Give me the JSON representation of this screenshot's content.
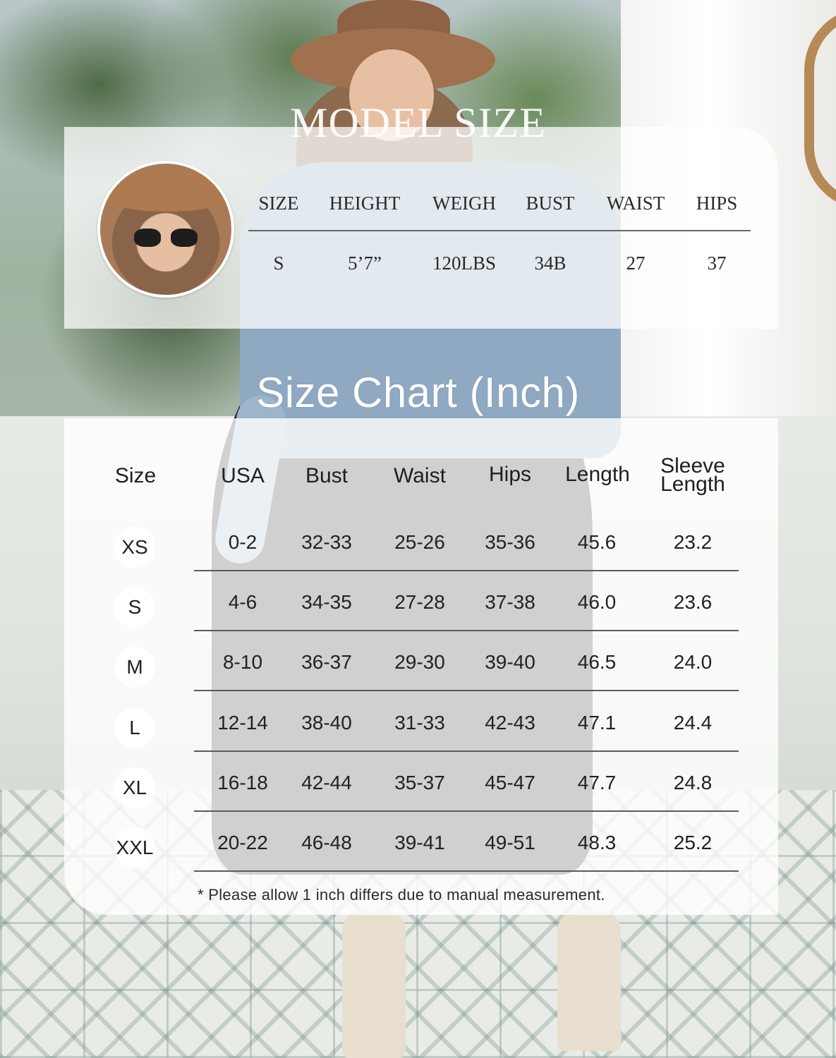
{
  "model_size": {
    "title": "MODEL SIZE",
    "headers": [
      "SIZE",
      "HEIGHT",
      "WEIGH",
      "BUST",
      "WAIST",
      "HIPS"
    ],
    "values": [
      "S",
      "5’7”",
      "120LBS",
      "34B",
      "27",
      "37"
    ]
  },
  "size_chart": {
    "title": "Size Chart (Inch)",
    "headers": [
      "Size",
      "USA",
      "Bust",
      "Waist",
      "Hips",
      "Length"
    ],
    "sleeve_header_line1": "Sleeve",
    "sleeve_header_line2": "Length",
    "rows": [
      {
        "size": "XS",
        "usa": "0-2",
        "bust": "32-33",
        "waist": "25-26",
        "hips": "35-36",
        "length": "45.6",
        "sleeve": "23.2"
      },
      {
        "size": "S",
        "usa": "4-6",
        "bust": "34-35",
        "waist": "27-28",
        "hips": "37-38",
        "length": "46.0",
        "sleeve": "23.6"
      },
      {
        "size": "M",
        "usa": "8-10",
        "bust": "36-37",
        "waist": "29-30",
        "hips": "39-40",
        "length": "46.5",
        "sleeve": "24.0"
      },
      {
        "size": "L",
        "usa": "12-14",
        "bust": "38-40",
        "waist": "31-33",
        "hips": "42-43",
        "length": "47.1",
        "sleeve": "24.4"
      },
      {
        "size": "XL",
        "usa": "16-18",
        "bust": "42-44",
        "waist": "35-37",
        "hips": "45-47",
        "length": "47.7",
        "sleeve": "24.8"
      },
      {
        "size": "XXL",
        "usa": "20-22",
        "bust": "46-48",
        "waist": "39-41",
        "hips": "49-51",
        "length": "48.3",
        "sleeve": "25.2"
      }
    ],
    "note": "* Please allow 1 inch differs due to manual measurement."
  }
}
